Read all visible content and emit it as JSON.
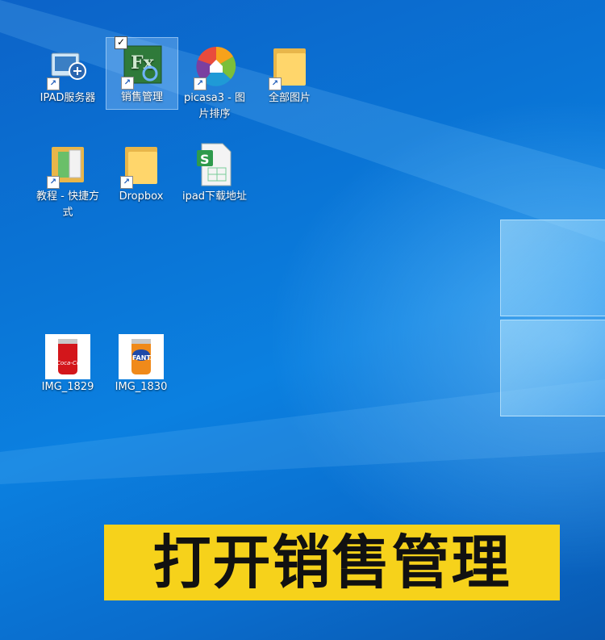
{
  "desktop": {
    "icons": [
      {
        "label": "IPAD服务器",
        "icon": "server-icon",
        "shortcut": true
      },
      {
        "label": "销售管理",
        "icon": "sales-app-icon",
        "shortcut": true,
        "selected": true,
        "checked": true
      },
      {
        "label": "picasa3 - 图片排序",
        "icon": "picasa-icon",
        "shortcut": true
      },
      {
        "label": "全部图片",
        "icon": "folder-icon",
        "shortcut": true
      },
      {
        "label": "教程 - 快捷方式",
        "icon": "folder-docs-icon",
        "shortcut": true
      },
      {
        "label": "Dropbox",
        "icon": "folder-icon",
        "shortcut": true
      },
      {
        "label": "ipad下载地址",
        "icon": "spreadsheet-icon",
        "shortcut": false
      },
      {
        "label": "IMG_1829",
        "icon": "coca-cola-image-icon",
        "shortcut": false
      },
      {
        "label": "IMG_1830",
        "icon": "fanta-image-icon",
        "shortcut": false
      }
    ],
    "shortcut_glyph": "↗",
    "check_glyph": "✓",
    "image_texts": {
      "coke": "Coca-Cola",
      "fanta": "FANTA"
    },
    "spreadsheet_letter": "S"
  },
  "caption": {
    "text": "打开销售管理"
  },
  "colors": {
    "desktop_blue": "#0a75d6",
    "caption_yellow": "#f6d21b"
  }
}
